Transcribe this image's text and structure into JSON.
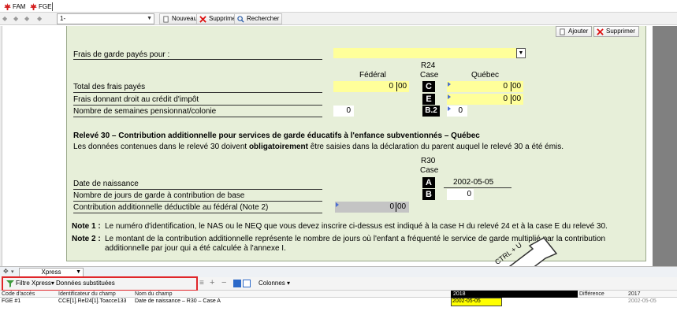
{
  "tabs": [
    {
      "label": "FAM",
      "icon": "maple-leaf-icon"
    },
    {
      "label": "FGE",
      "icon": "maple-leaf-icon"
    }
  ],
  "toolbar": {
    "form_select": "1-",
    "new_label": "Nouveau",
    "delete_label": "Supprimer",
    "search_label": "Rechercher"
  },
  "form": {
    "add_label": "Ajouter",
    "delete_label": "Supprimer",
    "paid_for_label": "Frais de garde payés pour :",
    "federal_header": "Fédéral",
    "r24_header": "R24",
    "r24_case": "Case",
    "quebec_header": "Québec",
    "total_label": "Total des frais payés",
    "total_fed": "0",
    "total_fed_cents": "00",
    "total_box": "C",
    "total_qc": "0",
    "total_qc_cents": "00",
    "credit_label": "Frais donnant droit au crédit d'impôt",
    "credit_box": "E",
    "credit_qc": "0",
    "credit_qc_cents": "00",
    "weeks_label": "Nombre de semaines pensionnat/colonie",
    "weeks_fed": "0",
    "weeks_box": "B.2",
    "weeks_qc": "0",
    "r30_title": "Relevé 30 – Contribution additionnelle pour services de garde éducatifs à l'enfance subventionnés – Québec",
    "r30_text_pre": "Les données contenues dans le relevé 30 doivent ",
    "r30_text_bold": "obligatoirement",
    "r30_text_post": " être saisies dans la déclaration du parent auquel le relevé 30 a été émis.",
    "r30_header": "R30",
    "r30_case": "Case",
    "birth_label": "Date de naissance",
    "birth_box": "A",
    "birth_value": "2002-05-05",
    "days_label": "Nombre de jours de garde à contribution de base",
    "days_box": "B",
    "days_value": "0",
    "contrib_label": "Contribution additionnelle déductible au fédéral (Note 2)",
    "contrib_value": "0",
    "contrib_cents": "00",
    "note1_label": "Note 1 :",
    "note1_text": "Le numéro d'identification, le NAS ou le NEQ que vous devez inscrire ci-dessus est indiqué à la case H du relevé 24 et à la case E du relevé 30.",
    "note2_label": "Note 2 :",
    "note2_text_1": "Le montant de la contribution additionnelle représente le nombre de jours où l'enfant a fréquenté le service de garde multiplié par la contribution",
    "note2_text_2": "additionnelle par jour qui a été calculée à l'annexe I."
  },
  "callout": {
    "text": "CTRL + U"
  },
  "xpress": {
    "select_label": "Xpress"
  },
  "filter": {
    "filter_label": "Filtre Xpress",
    "substituted_label": "Données substituées",
    "columns_label": "Colonnes"
  },
  "grid": {
    "headers": [
      "Code d'accès",
      "Identificateur du champ",
      "Nom du champ",
      "2018",
      "Différence",
      "2017"
    ],
    "rows": [
      [
        "FGE #1",
        "CCE[1].Rel24[1].Toacce133",
        "Date de naissance – R30 – Case A",
        "2002-05-05",
        "",
        "2002-05-05"
      ]
    ]
  },
  "colors": {
    "panel": "#e7efd9",
    "field": "#ffff9a",
    "highlight": "#e0262a"
  }
}
